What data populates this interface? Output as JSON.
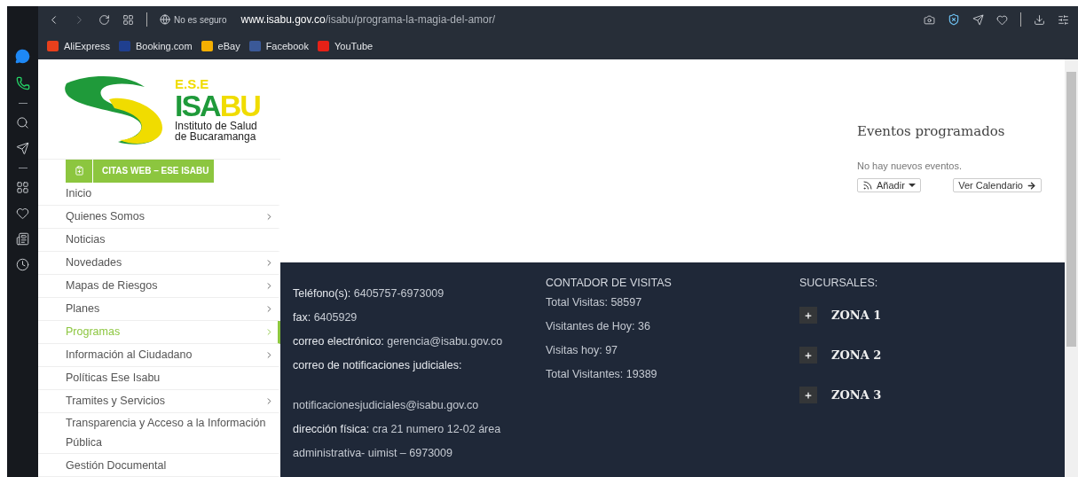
{
  "address_bar": {
    "security": "No es seguro",
    "host": "www.isabu.gov.co",
    "path": "/isabu/programa-la-magia-del-amor/"
  },
  "bookmarks": [
    {
      "label": "AliExpress",
      "color": "#e8401c"
    },
    {
      "label": "Booking.com",
      "color": "#1f3f8f"
    },
    {
      "label": "eBay",
      "color": "#f5af02"
    },
    {
      "label": "Facebook",
      "color": "#3b5998"
    },
    {
      "label": "YouTube",
      "color": "#e62117"
    }
  ],
  "logo": {
    "tag": "E.S.E",
    "name_a": "ISA",
    "name_b": "BU",
    "line_1": "Instituto de Salud",
    "line_2": "de Bucaramanga"
  },
  "citas_button": "CITAS WEB – ESE ISABU",
  "nav": [
    {
      "label": "Inicio",
      "selected": false,
      "submenu": false
    },
    {
      "label": "Quienes Somos",
      "selected": false,
      "submenu": true
    },
    {
      "label": "Noticias",
      "selected": false,
      "submenu": false
    },
    {
      "label": "Novedades",
      "selected": false,
      "submenu": true
    },
    {
      "label": "Mapas de Riesgos",
      "selected": false,
      "submenu": true
    },
    {
      "label": "Planes",
      "selected": false,
      "submenu": true
    },
    {
      "label": "Programas",
      "selected": true,
      "submenu": true
    },
    {
      "label": "Información al Ciudadano",
      "selected": false,
      "submenu": true
    },
    {
      "label": "Políticas Ese Isabu",
      "selected": false,
      "submenu": false
    },
    {
      "label": "Tramites y Servicios",
      "selected": false,
      "submenu": true
    },
    {
      "label": "Transparencia y Acceso a la Información Pública",
      "selected": false,
      "submenu": false
    },
    {
      "label": "Gestión Documental",
      "selected": false,
      "submenu": false
    }
  ],
  "events": {
    "title": "Eventos programados",
    "empty": "No hay nuevos eventos.",
    "add_button": "Añadir",
    "calendar_button": "Ver Calendario"
  },
  "contact": [
    "**Teléfono(s):** 6405757-6973009",
    "**fax:** 6405929",
    "**correo electrónico:** gerencia@isabu.gov.co",
    "**correo de notificaciones judiciales:**",
    "notificacionesjudiciales@isabu.gov.co",
    "**dirección física:** cra 21 numero 12-02 área administrativa- uimist – 6973009"
  ],
  "counter": {
    "title": "CONTADOR DE VISITAS",
    "lines": [
      "Total Visitas: 58597",
      "Visitantes de Hoy: 36",
      "Visitas hoy: 97",
      "Total Visitantes: 19389"
    ]
  },
  "branches": {
    "title": "SUCURSALES:",
    "zones": [
      "ZONA 1",
      "ZONA 2",
      "ZONA 3"
    ]
  }
}
